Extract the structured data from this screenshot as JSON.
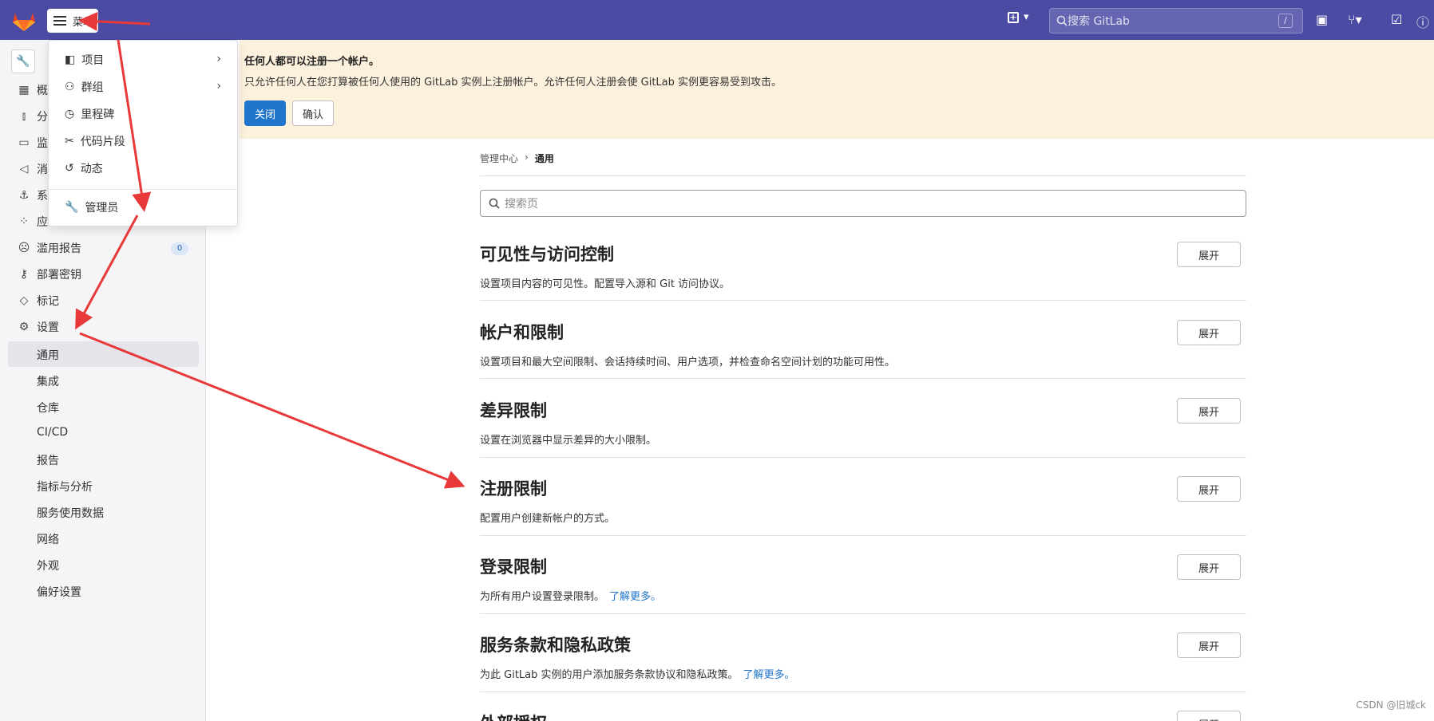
{
  "topbar": {
    "menu_label": "菜单",
    "search_placeholder": "搜索 GitLab",
    "search_shortcut": "/"
  },
  "banner": {
    "title": "任何人都可以注册一个帐户。",
    "text": "只允许任何人在您打算被任何人使用的 GitLab 实例上注册帐户。允许任何人注册会使 GitLab 实例更容易受到攻击。",
    "close_label": "关闭",
    "confirm_label": "确认"
  },
  "dropdown": {
    "items": [
      {
        "label": "项目",
        "icon": "project-icon"
      },
      {
        "label": "群组",
        "icon": "group-icon"
      },
      {
        "label": "里程碑",
        "icon": "clock-icon"
      },
      {
        "label": "代码片段",
        "icon": "scissors-icon"
      },
      {
        "label": "动态",
        "icon": "history-icon"
      },
      {
        "label": "管理员",
        "icon": "wrench-icon"
      }
    ]
  },
  "sidebar": {
    "partial_items": [
      "概",
      "分",
      "监",
      "消",
      "系",
      "应"
    ],
    "items": [
      {
        "label": "滥用报告",
        "badge": "0"
      },
      {
        "label": "部署密钥"
      },
      {
        "label": "标记"
      },
      {
        "label": "设置"
      }
    ],
    "sub_items": [
      "通用",
      "集成",
      "仓库",
      "CI/CD",
      "报告",
      "指标与分析",
      "服务使用数据",
      "网络",
      "外观",
      "偏好设置"
    ]
  },
  "breadcrumb": [
    "管理中心",
    "通用"
  ],
  "page_search_placeholder": "搜索页",
  "sections": [
    {
      "title": "可见性与访问控制",
      "desc": "设置项目内容的可见性。配置导入源和 Git 访问协议。",
      "link": "",
      "button": "展开"
    },
    {
      "title": "帐户和限制",
      "desc": "设置项目和最大空间限制、会话持续时间、用户选项，并检查命名空间计划的功能可用性。",
      "link": "",
      "button": "展开"
    },
    {
      "title": "差异限制",
      "desc": "设置在浏览器中显示差异的大小限制。",
      "link": "",
      "button": "展开"
    },
    {
      "title": "注册限制",
      "desc": "配置用户创建新帐户的方式。",
      "link": "",
      "button": "展开"
    },
    {
      "title": "登录限制",
      "desc": "为所有用户设置登录限制。",
      "link": "了解更多。",
      "button": "展开"
    },
    {
      "title": "服务条款和隐私政策",
      "desc": "为此 GitLab 实例的用户添加服务条款协议和隐私政策。",
      "link": "了解更多。",
      "button": "展开"
    },
    {
      "title": "外部授权",
      "desc": "",
      "link": "",
      "button": "展开"
    }
  ],
  "watermark": "CSDN @旧城ck",
  "colors": {
    "topbar": "#4b4ba3",
    "banner": "#fcf1dd",
    "primary": "#1f75cb",
    "annotation_arrow": "#e8393a"
  }
}
